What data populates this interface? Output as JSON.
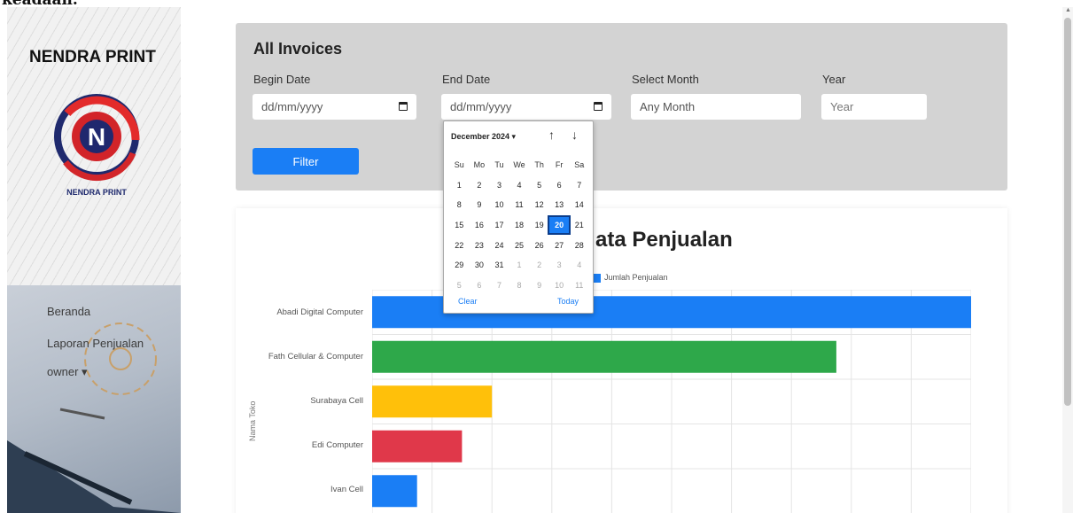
{
  "page_top_text": "keadaan.",
  "sidebar": {
    "brand": "NENDRA PRINT",
    "logo_caption": "NENDRA PRINT",
    "logo_letter": "N",
    "nav": [
      {
        "label": "Beranda"
      },
      {
        "label": "Laporan Penjualan"
      },
      {
        "label": "owner ▾"
      }
    ]
  },
  "filter_card": {
    "title": "All Invoices",
    "begin_date": {
      "label": "Begin Date",
      "value": "dd/mm/yyyy"
    },
    "end_date": {
      "label": "End Date",
      "value": "dd/mm/yyyy"
    },
    "month": {
      "label": "Select Month",
      "value": "Any Month"
    },
    "year": {
      "label": "Year",
      "placeholder": "Year"
    },
    "filter_button": "Filter"
  },
  "datepicker": {
    "month_label": "December 2024 ▾",
    "up_icon": "↑",
    "down_icon": "↓",
    "weekdays": [
      "Su",
      "Mo",
      "Tu",
      "We",
      "Th",
      "Fr",
      "Sa"
    ],
    "weeks": [
      [
        [
          "1",
          0
        ],
        [
          "2",
          0
        ],
        [
          "3",
          0
        ],
        [
          "4",
          0
        ],
        [
          "5",
          0
        ],
        [
          "6",
          0
        ],
        [
          "7",
          0
        ]
      ],
      [
        [
          "8",
          0
        ],
        [
          "9",
          0
        ],
        [
          "10",
          0
        ],
        [
          "11",
          0
        ],
        [
          "12",
          0
        ],
        [
          "13",
          0
        ],
        [
          "14",
          0
        ]
      ],
      [
        [
          "15",
          0
        ],
        [
          "16",
          0
        ],
        [
          "17",
          0
        ],
        [
          "18",
          0
        ],
        [
          "19",
          0
        ],
        [
          "20",
          2
        ],
        [
          "21",
          0
        ]
      ],
      [
        [
          "22",
          0
        ],
        [
          "23",
          0
        ],
        [
          "24",
          0
        ],
        [
          "25",
          0
        ],
        [
          "26",
          0
        ],
        [
          "27",
          0
        ],
        [
          "28",
          0
        ]
      ],
      [
        [
          "29",
          0
        ],
        [
          "30",
          0
        ],
        [
          "31",
          0
        ],
        [
          "1",
          1
        ],
        [
          "2",
          1
        ],
        [
          "3",
          1
        ],
        [
          "4",
          1
        ]
      ],
      [
        [
          "5",
          1
        ],
        [
          "6",
          1
        ],
        [
          "7",
          1
        ],
        [
          "8",
          1
        ],
        [
          "9",
          1
        ],
        [
          "10",
          1
        ],
        [
          "11",
          1
        ]
      ]
    ],
    "selected_day": "20",
    "clear_label": "Clear",
    "today_label": "Today"
  },
  "chart_data": {
    "type": "bar",
    "orientation": "horizontal",
    "title": "ata Penjualan",
    "legend": [
      {
        "name": "Jumlah Penjualan",
        "color": "#1a7ef5"
      }
    ],
    "ylabel": "Nama Toko",
    "categories": [
      "Abadi Digital Computer",
      "Fath Cellular & Computer",
      "Surabaya Cell",
      "Edi Computer",
      "Ivan Cell"
    ],
    "values": [
      20,
      15.5,
      4,
      3,
      1.5
    ],
    "colors": [
      "#1a7ef5",
      "#2ea84a",
      "#ffc00a",
      "#e0384a",
      "#1a7ef5"
    ],
    "xlim": [
      0,
      20
    ],
    "grid": true
  },
  "colors": {
    "primary": "#1a7ef5",
    "card_bg": "#d3d3d3"
  }
}
